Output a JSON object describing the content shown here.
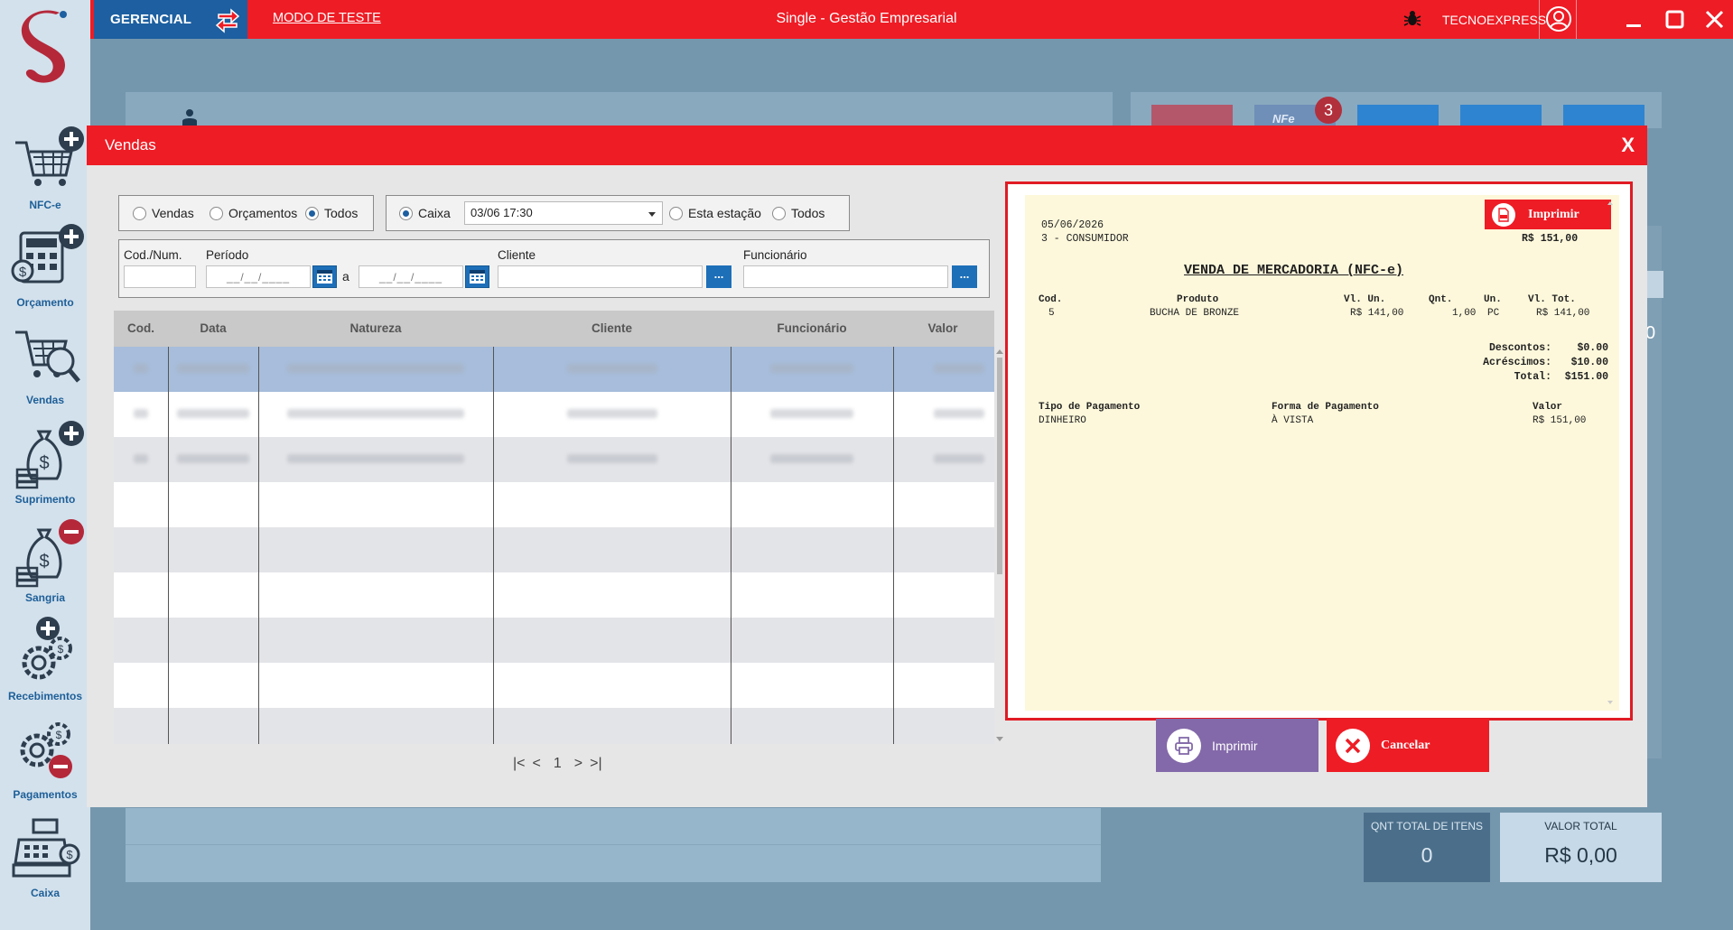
{
  "topbar": {
    "module": "GERENCIAL",
    "mode_link": "MODO DE TESTE",
    "title": "Single - Gestão Empresarial",
    "user": "TECNOEXPRESS"
  },
  "sidebar": {
    "items": [
      {
        "label": "NFC-e"
      },
      {
        "label": "Orçamento"
      },
      {
        "label": "Vendas"
      },
      {
        "label": "Suprimento"
      },
      {
        "label": "Sangria"
      },
      {
        "label": "Recebimentos"
      },
      {
        "label": "Pagamentos"
      },
      {
        "label": "Caixa"
      }
    ]
  },
  "background": {
    "badge_count": "3",
    "right_value": "0",
    "qnt_label": "QNT TOTAL DE ITENS",
    "qnt_value": "0",
    "valor_label": "VALOR TOTAL",
    "valor_value": "R$ 0,00",
    "nfe_tile": "NFe"
  },
  "modal": {
    "title": "Vendas",
    "close": "X",
    "filter_type": {
      "options": [
        "Vendas",
        "Orçamentos",
        "Todos"
      ],
      "selected": "Todos"
    },
    "filter_source": {
      "caixa_label": "Caixa",
      "caixa_value": "03/06 17:30",
      "estacao_label": "Esta estação",
      "todos_label": "Todos",
      "selected": "Caixa"
    },
    "fields": {
      "cod_label": "Cod./Num.",
      "periodo_label": "Período",
      "date_mask": "__/__/____",
      "a_label": "a",
      "cliente_label": "Cliente",
      "funcionario_label": "Funcionário",
      "dots": "..."
    },
    "table": {
      "headers": [
        "Cod.",
        "Data",
        "Natureza",
        "Cliente",
        "Funcionário",
        "Valor"
      ]
    },
    "pager": {
      "first": "|<",
      "prev": "<",
      "page": "1",
      "next": ">",
      "last": ">|"
    }
  },
  "receipt": {
    "print_label": "Imprimir",
    "date": "05/06/2026",
    "customer": "3 - CONSUMIDOR",
    "total_top": "R$ 151,00",
    "title": "VENDA DE MERCADORIA (NFC-e)",
    "item_headers": {
      "cod": "Cod.",
      "produto": "Produto",
      "vl_un": "Vl. Un.",
      "qnt": "Qnt.",
      "un": "Un.",
      "vl_tot": "Vl. Tot."
    },
    "item": {
      "cod": "5",
      "produto": "BUCHA DE BRONZE",
      "vl_un": "R$ 141,00",
      "qnt": "1,00",
      "un": "PC",
      "vl_tot": "R$ 141,00"
    },
    "descontos_label": "Descontos:",
    "descontos_value": "$0.00",
    "acrescimos_label": "Acréscimos:",
    "acrescimos_value": "$10.00",
    "total_label": "Total:",
    "total_value": "$151.00",
    "payment_headers": {
      "tipo": "Tipo de Pagamento",
      "forma": "Forma de Pagamento",
      "valor": "Valor"
    },
    "payment": {
      "tipo": "DINHEIRO",
      "forma": "À VISTA",
      "valor": "R$ 151,00"
    }
  },
  "actions": {
    "imprimir": "Imprimir",
    "cancelar": "Cancelar"
  },
  "colors": {
    "brand_red": "#ee1c25",
    "brand_blue": "#1d5fa0",
    "purple": "#8369a9",
    "receipt_bg": "#fdf8db"
  }
}
